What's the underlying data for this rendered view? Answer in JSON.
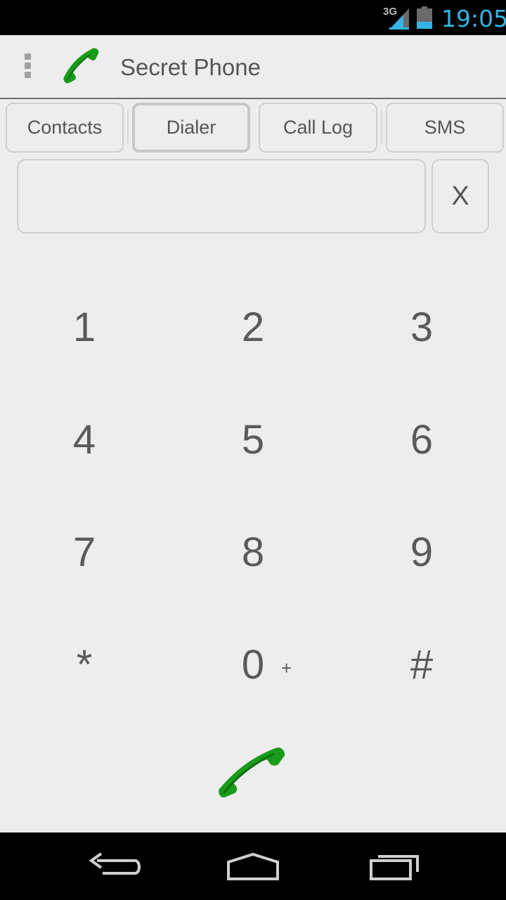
{
  "status_bar": {
    "network": "3G",
    "time": "19:05",
    "accent_color": "#33b5e5"
  },
  "action_bar": {
    "title": "Secret Phone",
    "menu_icon": "overflow-menu-icon",
    "app_icon": "phone-handset-icon",
    "icon_color": "#1a9a1a"
  },
  "tabs": [
    {
      "label": "Contacts",
      "selected": false
    },
    {
      "label": "Dialer",
      "selected": true
    },
    {
      "label": "Call Log",
      "selected": false
    },
    {
      "label": "SMS",
      "selected": false
    }
  ],
  "dialer": {
    "number_value": "",
    "clear_label": "X"
  },
  "keypad": {
    "keys": [
      {
        "main": "1",
        "sub": ""
      },
      {
        "main": "2",
        "sub": ""
      },
      {
        "main": "3",
        "sub": ""
      },
      {
        "main": "4",
        "sub": ""
      },
      {
        "main": "5",
        "sub": ""
      },
      {
        "main": "6",
        "sub": ""
      },
      {
        "main": "7",
        "sub": ""
      },
      {
        "main": "8",
        "sub": ""
      },
      {
        "main": "9",
        "sub": ""
      },
      {
        "main": "*",
        "sub": ""
      },
      {
        "main": "0",
        "sub": "+"
      },
      {
        "main": "#",
        "sub": ""
      }
    ]
  },
  "call_button": {
    "icon": "phone-handset-icon"
  },
  "nav_bar": {
    "back_icon": "back-icon",
    "home_icon": "home-icon",
    "recents_icon": "recent-apps-icon"
  }
}
